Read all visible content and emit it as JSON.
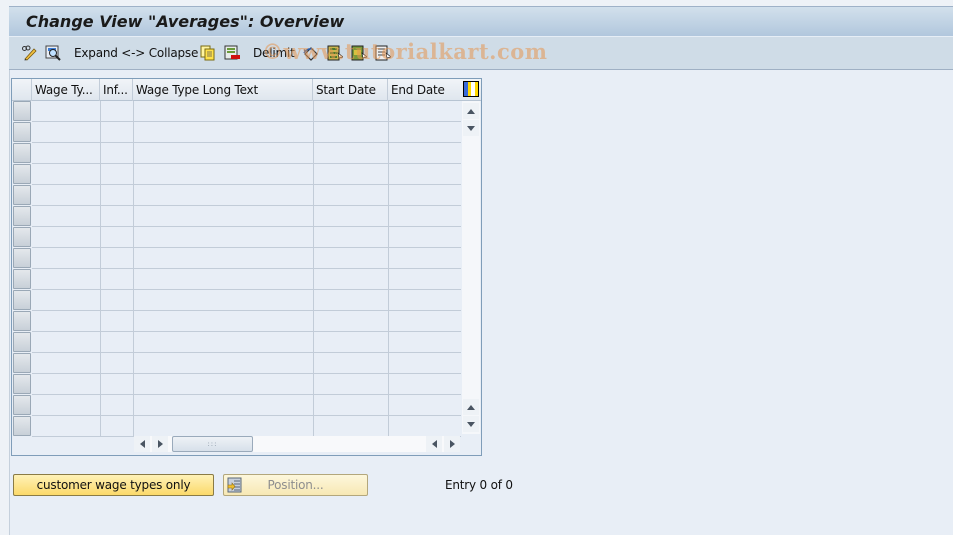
{
  "window": {
    "title": "Change View \"Averages\": Overview"
  },
  "toolbar": {
    "items": [
      {
        "name": "display-change-toggle-icon",
        "label": ""
      },
      {
        "name": "details-icon",
        "label": ""
      },
      {
        "name": "expand-collapse",
        "label": "Expand <-> Collapse"
      },
      {
        "name": "copy-as-icon",
        "label": ""
      },
      {
        "name": "delete-icon",
        "label": ""
      },
      {
        "name": "delimit",
        "label": "Delimit"
      },
      {
        "name": "undo-change-icon",
        "label": ""
      },
      {
        "name": "select-all-icon",
        "label": ""
      },
      {
        "name": "select-block-icon",
        "label": ""
      },
      {
        "name": "deselect-all-icon",
        "label": ""
      }
    ],
    "watermark": "©www.tutorialkart.com"
  },
  "table": {
    "columns": [
      {
        "key": "wage_type",
        "label": "Wage Ty..."
      },
      {
        "key": "info",
        "label": "Inf..."
      },
      {
        "key": "long_text",
        "label": "Wage Type Long Text"
      },
      {
        "key": "start_date",
        "label": "Start Date"
      },
      {
        "key": "end_date",
        "label": "End Date"
      }
    ],
    "rows": [],
    "visible_empty_rows": 16
  },
  "buttons": {
    "customer_wage_types": "customer wage types only",
    "position": "Position..."
  },
  "status": {
    "entry_text": "Entry 0 of 0"
  },
  "colors": {
    "title_bar": "#b1c7dd",
    "toolbar": "#cfdce7",
    "background": "#e8eef6",
    "primary_button": "#fbd96a",
    "grid_line": "#c2ccd8"
  }
}
